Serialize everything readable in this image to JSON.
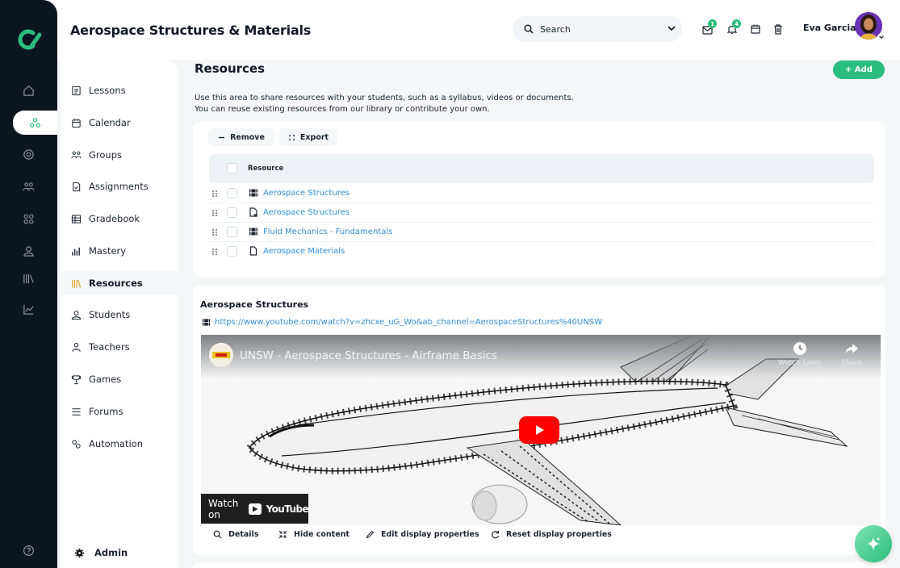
{
  "app": {
    "title": "Aerospace Structures & Materials"
  },
  "header": {
    "search_label": "Search",
    "notifications": [
      {
        "name": "messages",
        "badge": "1"
      },
      {
        "name": "alerts",
        "badge": "4"
      }
    ],
    "user_name": "Eva Garcia"
  },
  "nav": {
    "items": [
      {
        "label": "Lessons",
        "icon": "lessons-icon"
      },
      {
        "label": "Calendar",
        "icon": "calendar-icon"
      },
      {
        "label": "Groups",
        "icon": "groups-icon"
      },
      {
        "label": "Assignments",
        "icon": "assignments-icon"
      },
      {
        "label": "Gradebook",
        "icon": "gradebook-icon"
      },
      {
        "label": "Mastery",
        "icon": "mastery-icon"
      },
      {
        "label": "Resources",
        "icon": "resources-icon",
        "active": true
      },
      {
        "label": "Students",
        "icon": "students-icon"
      },
      {
        "label": "Teachers",
        "icon": "teachers-icon"
      },
      {
        "label": "Games",
        "icon": "games-icon"
      },
      {
        "label": "Forums",
        "icon": "forums-icon"
      },
      {
        "label": "Automation",
        "icon": "automation-icon"
      }
    ],
    "admin_label": "Admin"
  },
  "resources": {
    "title": "Resources",
    "add_label": "+ Add",
    "description_line1": "Use this area to share resources with your students, such as a syllabus, videos or documents.",
    "description_line2": "You can reuse existing resources from our library or contribute your own.",
    "toolbar": {
      "remove_label": "Remove",
      "export_label": "Export"
    },
    "column_header": "Resource",
    "rows": [
      {
        "label": "Aerospace Structures",
        "type": "video"
      },
      {
        "label": "Aerospace Structures",
        "type": "file-link"
      },
      {
        "label": "Fluid Mechanics - Fundamentals",
        "type": "video"
      },
      {
        "label": "Aerospace Materials",
        "type": "document"
      }
    ]
  },
  "detail": {
    "title": "Aerospace Structures",
    "url": "https://www.youtube.com/watch?v=zhcxe_uG_Wo&ab_channel=AerospaceStructures%40UNSW",
    "video": {
      "title": "UNSW - Aerospace Structures - Airframe Basics",
      "watch_later": "Watch Later",
      "share": "Share",
      "watch_on": "Watch on",
      "youtube": "YouTube"
    },
    "actions": {
      "details": "Details",
      "hide_content": "Hide content",
      "edit_display": "Edit display properties",
      "reset_display": "Reset display properties"
    }
  },
  "colors": {
    "accent_green": "#2bbd7e",
    "link_blue": "#2f8fd8",
    "rail_dark": "#0b1620",
    "youtube_red": "#ff0000"
  }
}
